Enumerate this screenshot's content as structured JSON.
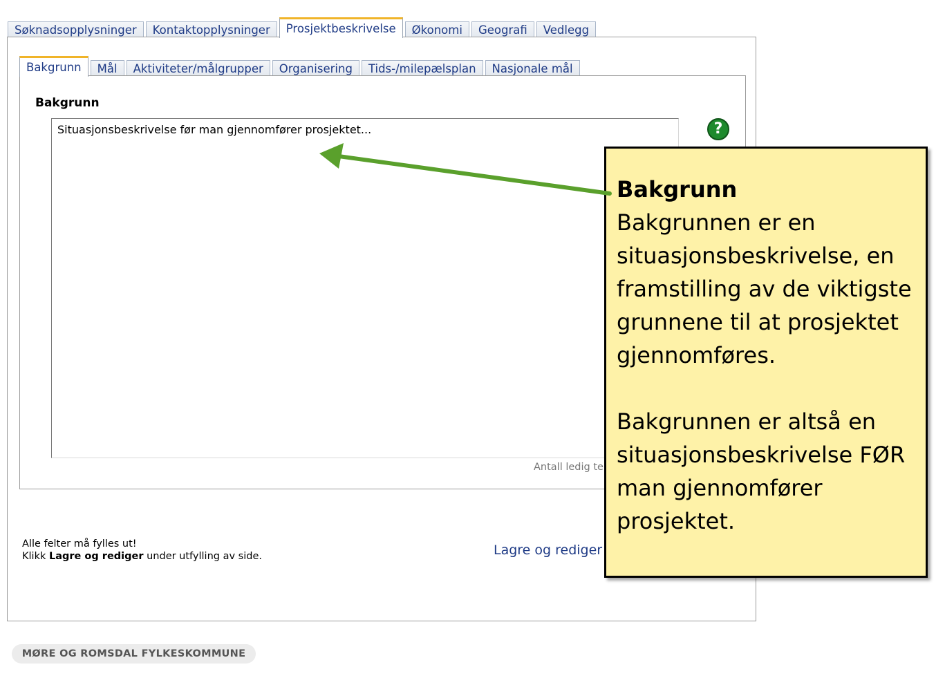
{
  "outer_tabs": [
    {
      "label": "Søknadsopplysninger",
      "active": false
    },
    {
      "label": "Kontaktopplysninger",
      "active": false
    },
    {
      "label": "Prosjektbeskrivelse",
      "active": true
    },
    {
      "label": "Økonomi",
      "active": false
    },
    {
      "label": "Geografi",
      "active": false
    },
    {
      "label": "Vedlegg",
      "active": false
    }
  ],
  "inner_tabs": [
    {
      "label": "Bakgrunn",
      "active": true
    },
    {
      "label": "Mål",
      "active": false
    },
    {
      "label": "Aktiviteter/målgrupper",
      "active": false
    },
    {
      "label": "Organisering",
      "active": false
    },
    {
      "label": "Tids-/milepælsplan",
      "active": false
    },
    {
      "label": "Nasjonale mål",
      "active": false
    }
  ],
  "form": {
    "section_label": "Bakgrunn",
    "textarea_value": "Situasjonsbeskrivelse før man gjennomfører prosjektet...",
    "help_icon": "?",
    "char_count_label": "Antall ledig te"
  },
  "notes": {
    "line1": "Alle felter må fylles ut!",
    "line2_prefix": "Klikk ",
    "line2_bold": "Lagre og rediger",
    "line2_suffix": " under utfylling av side."
  },
  "actions": {
    "save_link": "Lagre og rediger"
  },
  "footer": {
    "org_name": "MØRE OG ROMSDAL FYLKESKOMMUNE"
  },
  "callout": {
    "title": "Bakgrunn",
    "body1": "Bakgrunnen er en situasjonsbeskrivelse, en framstilling av de viktigste grunnene til at prosjektet gjennomføres.",
    "body2": "Bakgrunnen er altså en situasjonsbeskrivelse FØR man gjennomfører prosjektet."
  },
  "colors": {
    "callout_bg": "#fef2a8",
    "arrow": "#5aa02c",
    "tab_text": "#1f3b86",
    "active_tab_accent": "#f0b429",
    "help_icon": "#1e8a2d"
  }
}
